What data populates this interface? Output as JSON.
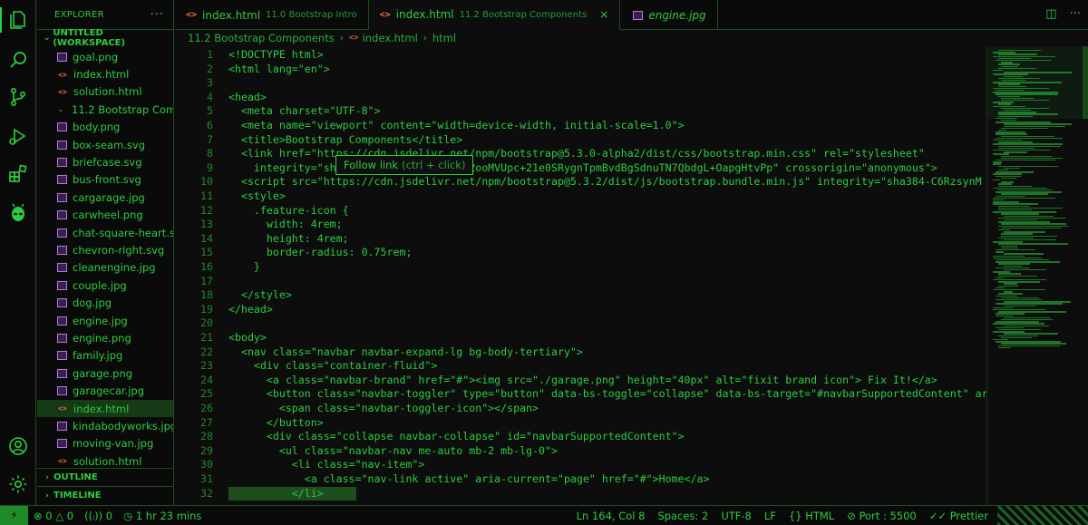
{
  "sidebar": {
    "title": "EXPLORER",
    "more": "···",
    "workspace": "UNTITLED (WORKSPACE)",
    "folder": "11.2 Bootstrap Com...",
    "files_top": [
      {
        "name": "goal.png",
        "type": "img"
      },
      {
        "name": "index.html",
        "type": "html"
      },
      {
        "name": "solution.html",
        "type": "html"
      }
    ],
    "files": [
      {
        "name": "body.png",
        "type": "img"
      },
      {
        "name": "box-seam.svg",
        "type": "img"
      },
      {
        "name": "briefcase.svg",
        "type": "img"
      },
      {
        "name": "bus-front.svg",
        "type": "img"
      },
      {
        "name": "cargarage.jpg",
        "type": "img"
      },
      {
        "name": "carwheel.png",
        "type": "img"
      },
      {
        "name": "chat-square-heart.s...",
        "type": "img"
      },
      {
        "name": "chevron-right.svg",
        "type": "img"
      },
      {
        "name": "cleanengine.jpg",
        "type": "img"
      },
      {
        "name": "couple.jpg",
        "type": "img"
      },
      {
        "name": "dog.jpg",
        "type": "img"
      },
      {
        "name": "engine.jpg",
        "type": "img"
      },
      {
        "name": "engine.png",
        "type": "img"
      },
      {
        "name": "family.jpg",
        "type": "img"
      },
      {
        "name": "garage.png",
        "type": "img"
      },
      {
        "name": "garagecar.jpg",
        "type": "img"
      },
      {
        "name": "index.html",
        "type": "html",
        "selected": true
      },
      {
        "name": "kindabodyworks.jpg",
        "type": "img"
      },
      {
        "name": "moving-van.jpg",
        "type": "img"
      },
      {
        "name": "solution.html",
        "type": "html"
      }
    ],
    "outline": "OUTLINE",
    "timeline": "TIMELINE"
  },
  "tabs": [
    {
      "label": "index.html",
      "desc": "11.0 Bootstrap Intro",
      "icon": "<>",
      "active": false,
      "italic": false
    },
    {
      "label": "index.html",
      "desc": "11.2 Bootstrap Components",
      "icon": "<>",
      "active": true,
      "italic": false,
      "close": "×"
    },
    {
      "label": "engine.jpg",
      "desc": "",
      "icon": "img",
      "active": false,
      "italic": true
    }
  ],
  "breadcrumb": {
    "folder": "11.2 Bootstrap Components",
    "file": "index.html",
    "file_icon": "<>",
    "symbol": "html"
  },
  "editor": {
    "lines": [
      {
        "n": "1",
        "text": "<!DOCTYPE html>"
      },
      {
        "n": "2",
        "text": "<html lang=\"en\">"
      },
      {
        "n": "3",
        "text": ""
      },
      {
        "n": "4",
        "text": "<head>"
      },
      {
        "n": "5",
        "text": "  <meta charset=\"UTF-8\">"
      },
      {
        "n": "6",
        "text": "  <meta name=\"viewport\" content=\"width=device-width, initial-scale=1.0\">"
      },
      {
        "n": "7",
        "text": "  <title>Bootstrap Components</title>"
      },
      {
        "n": "8",
        "text": "  <link href=\"https://cdn.jsdelivr.net/npm/bootstrap@5.3.0-alpha2/dist/css/bootstrap.min.css\" rel=\"stylesheet\""
      },
      {
        "n": "9",
        "text": "    integrity=\"sha384-aFq/bzH65dt+w6FI2ooMVUpc+21e0SRygnTpmBvdBgSdnuTN7QbdgL+OapgHtvPp\" crossorigin=\"anonymous\">"
      },
      {
        "n": "10",
        "text": "  <script src=\"https://cdn.jsdelivr.net/npm/bootstrap@5.3.2/dist/js/bootstrap.bundle.min.js\" integrity=\"sha384-C6RzsynM"
      },
      {
        "n": "11",
        "text": "  <style>"
      },
      {
        "n": "12",
        "text": "    .feature-icon {"
      },
      {
        "n": "13",
        "text": "      width: 4rem;"
      },
      {
        "n": "14",
        "text": "      height: 4rem;"
      },
      {
        "n": "15",
        "text": "      border-radius: 0.75rem;"
      },
      {
        "n": "16",
        "text": "    }"
      },
      {
        "n": "17",
        "text": ""
      },
      {
        "n": "18",
        "text": "  </style>"
      },
      {
        "n": "19",
        "text": "</head>"
      },
      {
        "n": "20",
        "text": ""
      },
      {
        "n": "21",
        "text": "<body>"
      },
      {
        "n": "22",
        "text": "  <nav class=\"navbar navbar-expand-lg bg-body-tertiary\">"
      },
      {
        "n": "23",
        "text": "    <div class=\"container-fluid\">"
      },
      {
        "n": "24",
        "text": "      <a class=\"navbar-brand\" href=\"#\"><img src=\"./garage.png\" height=\"40px\" alt=\"fixit brand icon\"> Fix It!</a>"
      },
      {
        "n": "25",
        "text": "      <button class=\"navbar-toggler\" type=\"button\" data-bs-toggle=\"collapse\" data-bs-target=\"#navbarSupportedContent\" ari"
      },
      {
        "n": "26",
        "text": "        <span class=\"navbar-toggler-icon\"></span>"
      },
      {
        "n": "27",
        "text": "      </button>"
      },
      {
        "n": "28",
        "text": "      <div class=\"collapse navbar-collapse\" id=\"navbarSupportedContent\">"
      },
      {
        "n": "29",
        "text": "        <ul class=\"navbar-nav me-auto mb-2 mb-lg-0\">"
      },
      {
        "n": "30",
        "text": "          <li class=\"nav-item\">"
      },
      {
        "n": "31",
        "text": "            <a class=\"nav-link active\" aria-current=\"page\" href=\"#\">Home</a>"
      },
      {
        "n": "32",
        "text": "          </li>"
      }
    ],
    "tooltip": {
      "label": "Follow link",
      "hint": "(ctrl + click)"
    }
  },
  "status": {
    "remote": "⚡",
    "errors": "0",
    "warnings": "0",
    "ports": "0",
    "time": "1 hr 23 mins",
    "position": "Ln 164, Col 8",
    "spaces": "Spaces: 2",
    "encoding": "UTF-8",
    "eol": "LF",
    "language": "HTML",
    "port": "Port : 5500",
    "prettier": "Prettier"
  },
  "colors": {
    "accent": "#2ecc40",
    "background": "#0d0d0d",
    "html_icon": "#e8734a",
    "image_icon": "#b07bd8"
  }
}
